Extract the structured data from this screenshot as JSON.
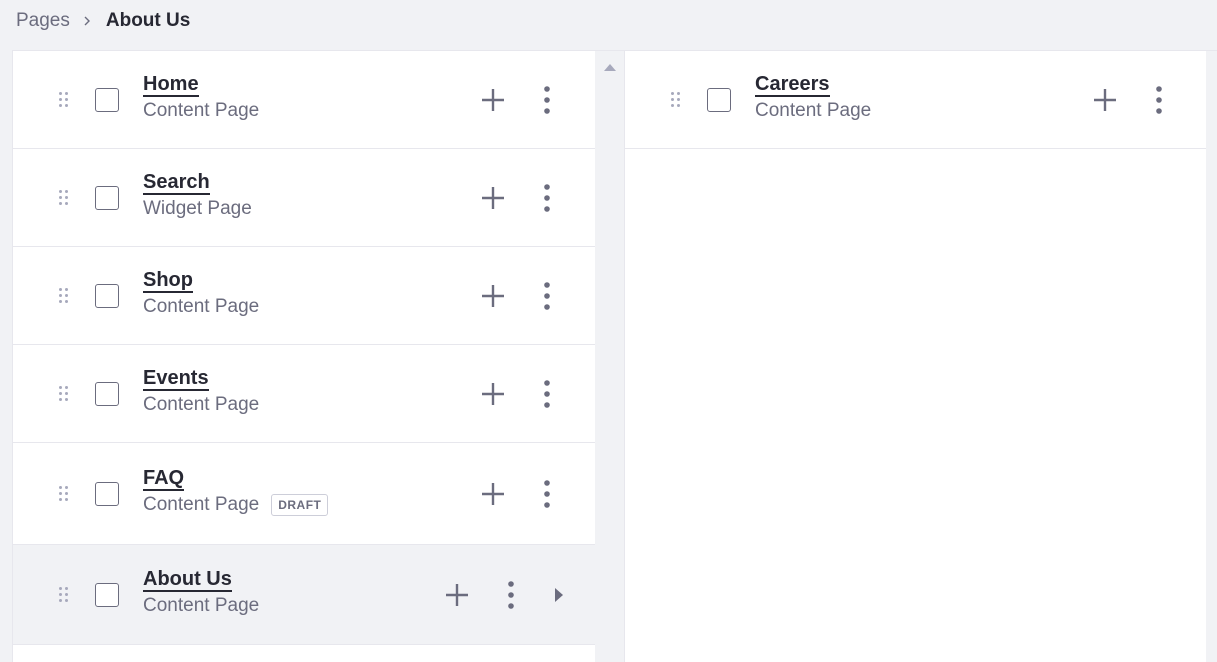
{
  "breadcrumb": {
    "parent": "Pages",
    "current": "About Us"
  },
  "left_column": {
    "items": [
      {
        "title": "Home",
        "type": "Content Page",
        "badge": ""
      },
      {
        "title": "Search",
        "type": "Widget Page",
        "badge": ""
      },
      {
        "title": "Shop",
        "type": "Content Page",
        "badge": ""
      },
      {
        "title": "Events",
        "type": "Content Page",
        "badge": ""
      },
      {
        "title": "FAQ",
        "type": "Content Page",
        "badge": "DRAFT"
      },
      {
        "title": "About Us",
        "type": "Content Page",
        "badge": ""
      }
    ]
  },
  "right_column": {
    "items": [
      {
        "title": "Careers",
        "type": "Content Page"
      }
    ]
  },
  "icons": {
    "drag": "drag-handle-icon",
    "add": "plus-icon",
    "actions": "ellipsis-vertical-icon",
    "expand": "caret-right-icon",
    "breadcrumb_sep": "chevron-right-icon"
  },
  "colors": {
    "background": "#f1f2f5",
    "text_primary": "#272833",
    "text_secondary": "#6b6c7e",
    "border": "#e7e7ed"
  }
}
